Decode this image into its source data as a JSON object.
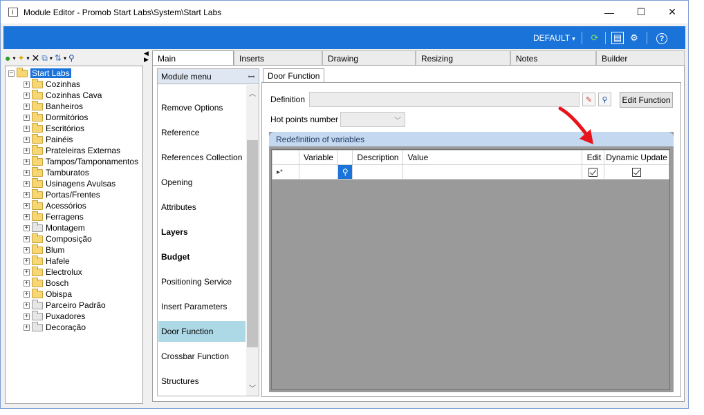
{
  "window": {
    "title": "Module Editor - Promob Start Labs\\System\\Start Labs",
    "minimize": "—",
    "maximize": "☐",
    "close": "✕"
  },
  "toolbar": {
    "profile": "DEFAULT",
    "profile_caret": "▾"
  },
  "tree": {
    "root": "Start Labs",
    "items": [
      {
        "label": "Cozinhas",
        "kind": "yellow"
      },
      {
        "label": "Cozinhas Cava",
        "kind": "yellow"
      },
      {
        "label": "Banheiros",
        "kind": "yellow"
      },
      {
        "label": "Dormitórios",
        "kind": "yellow"
      },
      {
        "label": "Escritórios",
        "kind": "yellow"
      },
      {
        "label": "Painéis",
        "kind": "yellow"
      },
      {
        "label": "Prateleiras Externas",
        "kind": "yellow"
      },
      {
        "label": "Tampos/Tamponamentos",
        "kind": "yellow"
      },
      {
        "label": "Tamburatos",
        "kind": "yellow"
      },
      {
        "label": "Usinagens Avulsas",
        "kind": "yellow"
      },
      {
        "label": "Portas/Frentes",
        "kind": "yellow"
      },
      {
        "label": "Acessórios",
        "kind": "yellow"
      },
      {
        "label": "Ferragens",
        "kind": "yellow"
      },
      {
        "label": "Montagem",
        "kind": "grey"
      },
      {
        "label": "Composição",
        "kind": "yellow"
      },
      {
        "label": "Blum",
        "kind": "yellow"
      },
      {
        "label": "Hafele",
        "kind": "yellow"
      },
      {
        "label": "Electrolux",
        "kind": "yellow"
      },
      {
        "label": "Bosch",
        "kind": "yellow"
      },
      {
        "label": "Obispa",
        "kind": "yellow"
      },
      {
        "label": "Parceiro Padrão",
        "kind": "grey"
      },
      {
        "label": "Puxadores",
        "kind": "grey"
      },
      {
        "label": "Decoração",
        "kind": "grey"
      }
    ]
  },
  "tabs": [
    "Main",
    "Inserts",
    "Drawing",
    "Resizing",
    "Notes",
    "Builder"
  ],
  "module_menu": {
    "title": "Module menu",
    "items": [
      {
        "label": "Remove Options",
        "bold": false
      },
      {
        "label": "Reference",
        "bold": false
      },
      {
        "label": "References Collection",
        "bold": false
      },
      {
        "label": "Opening",
        "bold": false
      },
      {
        "label": "Attributes",
        "bold": false
      },
      {
        "label": "Layers",
        "bold": true
      },
      {
        "label": "Budget",
        "bold": true
      },
      {
        "label": "Positioning Service",
        "bold": false
      },
      {
        "label": "Insert Parameters",
        "bold": false
      },
      {
        "label": "Door Function",
        "bold": false
      },
      {
        "label": "Crossbar Function",
        "bold": false
      },
      {
        "label": "Structures",
        "bold": false
      }
    ]
  },
  "door_function": {
    "tab": "Door Function",
    "definition_label": "Definition",
    "definition_value": "",
    "edit_button": "Edit Function",
    "hotpoints_label": "Hot points number",
    "redefinition_title": "Redefinition of variables",
    "columns": [
      "Variable",
      "Description",
      "Value",
      "Edit",
      "Dynamic Update"
    ],
    "new_row_marker": "▸*"
  },
  "colors": {
    "accent": "#1a73d9",
    "arrow": "#e8141b",
    "selected_menu": "#add8e6"
  }
}
